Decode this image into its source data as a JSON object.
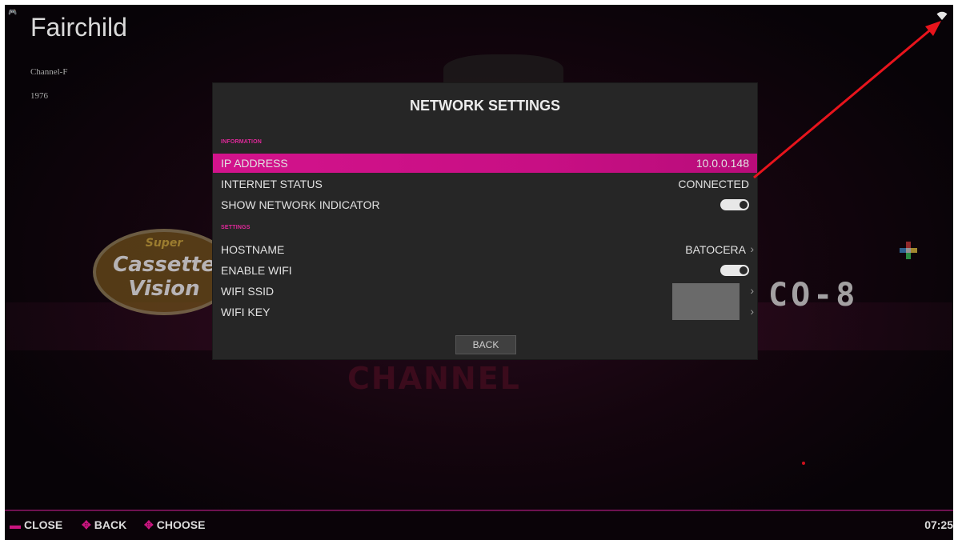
{
  "system": {
    "name": "Fairchild",
    "model": "Channel-F",
    "year": "1976"
  },
  "background": {
    "logo_left_line1": "Super",
    "logo_left_line2": "Cassette",
    "logo_left_line3": "Vision",
    "logo_right": "CO-8"
  },
  "dialog": {
    "title": "NETWORK SETTINGS",
    "sections": [
      {
        "header": "INFORMATION",
        "rows": [
          {
            "label": "IP ADDRESS",
            "value": "10.0.0.148"
          },
          {
            "label": "INTERNET STATUS",
            "value": "CONNECTED"
          },
          {
            "label": "SHOW NETWORK INDICATOR",
            "toggle": true
          }
        ]
      },
      {
        "header": "SETTINGS",
        "rows": [
          {
            "label": "HOSTNAME",
            "value": "BATOCERA",
            "chevron": "›"
          },
          {
            "label": "ENABLE WIFI",
            "toggle": true
          },
          {
            "label": "WIFI SSID",
            "chevron": "›"
          },
          {
            "label": "WIFI KEY",
            "chevron": "›"
          }
        ]
      }
    ],
    "back_label": "BACK"
  },
  "footer": {
    "hints": [
      {
        "icon": "▬",
        "label": "CLOSE"
      },
      {
        "icon": "✥",
        "label": "BACK"
      },
      {
        "icon": "✥",
        "label": "CHOOSE"
      }
    ],
    "clock": "07:25"
  },
  "colors": {
    "accent": "#d3138c",
    "annotation_arrow": "#e8141c"
  }
}
